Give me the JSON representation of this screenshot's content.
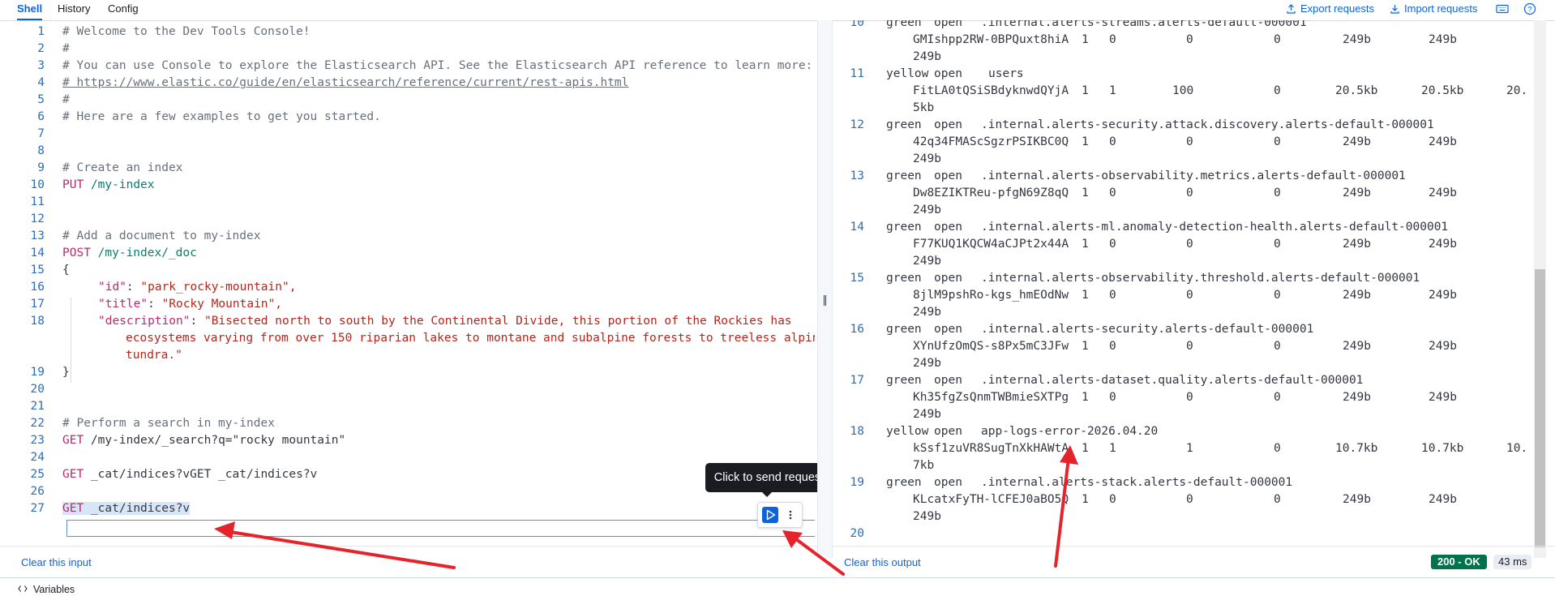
{
  "tabs": [
    {
      "label": "Shell",
      "active": true
    },
    {
      "label": "History",
      "active": false
    },
    {
      "label": "Config",
      "active": false
    }
  ],
  "toolbar": {
    "export_label": "Export requests",
    "import_label": "Import requests",
    "export_icon": "upload-icon",
    "import_icon": "download-icon",
    "keyboard_icon": "keyboard-icon",
    "help_icon": "help-icon"
  },
  "editor": {
    "lines": [
      {
        "n": "1",
        "text": "# Welcome to the Dev Tools Console!"
      },
      {
        "n": "2",
        "text": "#"
      },
      {
        "n": "3",
        "text": "# You can use Console to explore the Elasticsearch API. See the Elasticsearch API reference to learn more:"
      },
      {
        "n": "4",
        "text": "# https://www.elastic.co/guide/en/elasticsearch/reference/current/rest-apis.html"
      },
      {
        "n": "5",
        "text": "#"
      },
      {
        "n": "6",
        "text": "# Here are a few examples to get you started."
      },
      {
        "n": "7",
        "text": ""
      },
      {
        "n": "8",
        "text": ""
      },
      {
        "n": "9",
        "text": "# Create an index"
      },
      {
        "n": "10",
        "method": "PUT",
        "path": "/my-index"
      },
      {
        "n": "11",
        "text": ""
      },
      {
        "n": "12",
        "text": ""
      },
      {
        "n": "13",
        "text": "# Add a document to my-index"
      },
      {
        "n": "14",
        "method": "POST",
        "path": "/my-index/_doc"
      },
      {
        "n": "15",
        "text": "{"
      },
      {
        "n": "16",
        "key": "\"id\"",
        "value": "\"park_rocky-mountain\","
      },
      {
        "n": "17",
        "key": "\"title\"",
        "value": "\"Rocky Mountain\","
      },
      {
        "n": "18",
        "key": "\"description\"",
        "value": "\"Bisected north to south by the Continental Divide, this portion of the Rockies has"
      },
      {
        "n": "",
        "text": "ecosystems varying from over 150 riparian lakes to montane and subalpine forests to treeless alpine"
      },
      {
        "n": "",
        "text": "tundra.\""
      },
      {
        "n": "19",
        "text": "}"
      },
      {
        "n": "20",
        "text": ""
      },
      {
        "n": "21",
        "text": ""
      },
      {
        "n": "22",
        "text": "# Perform a search in my-index"
      },
      {
        "n": "23",
        "method": "GET",
        "path": "/my-index/_search?q=\"rocky mountain\""
      },
      {
        "n": "24",
        "text": ""
      },
      {
        "n": "25",
        "method": "GET",
        "path": "_cat/indices?vGET _cat/indices?v"
      },
      {
        "n": "26",
        "text": ""
      },
      {
        "n": "27",
        "method": "GET",
        "path": "_cat/indices?v"
      }
    ],
    "tooltip": "Click to send request",
    "send_icon": "play-icon",
    "more_icon": "more-vertical-icon",
    "clear_label": "Clear this input"
  },
  "output": {
    "rows": [
      {
        "n": "10",
        "health": "green",
        "status": "open",
        "index": ".internal.alerts-streams.alerts-default-000001",
        "uuid": "GMIshpp2RW-0BPQuxt8hiA",
        "pri": "1",
        "rep": "0",
        "docs": "0",
        "del": "0",
        "size": "249b",
        "pri_size": "249b",
        "wrap": "249b"
      },
      {
        "n": "11",
        "health": "yellow",
        "status": "open",
        "index": "users",
        "uuid": "FitLA0tQSiSBdyknwdQYjA",
        "pri": "1",
        "rep": "1",
        "docs": "100",
        "del": "0",
        "size": "20.5kb",
        "pri_size": "20.5kb",
        "extra": "20.",
        "wrap": "5kb"
      },
      {
        "n": "12",
        "health": "green",
        "status": "open",
        "index": ".internal.alerts-security.attack.discovery.alerts-default-000001",
        "uuid": "42q34FMAScSgzrPSIKBC0Q",
        "pri": "1",
        "rep": "0",
        "docs": "0",
        "del": "0",
        "size": "249b",
        "pri_size": "249b",
        "wrap": "249b"
      },
      {
        "n": "13",
        "health": "green",
        "status": "open",
        "index": ".internal.alerts-observability.metrics.alerts-default-000001",
        "uuid": "Dw8EZIKTReu-pfgN69Z8qQ",
        "pri": "1",
        "rep": "0",
        "docs": "0",
        "del": "0",
        "size": "249b",
        "pri_size": "249b",
        "wrap": "249b"
      },
      {
        "n": "14",
        "health": "green",
        "status": "open",
        "index": ".internal.alerts-ml.anomaly-detection-health.alerts-default-000001",
        "uuid": "F77KUQ1KQCW4aCJPt2x44A",
        "pri": "1",
        "rep": "0",
        "docs": "0",
        "del": "0",
        "size": "249b",
        "pri_size": "249b",
        "wrap": "249b"
      },
      {
        "n": "15",
        "health": "green",
        "status": "open",
        "index": ".internal.alerts-observability.threshold.alerts-default-000001",
        "uuid": "8jlM9pshRo-kgs_hmEOdNw",
        "pri": "1",
        "rep": "0",
        "docs": "0",
        "del": "0",
        "size": "249b",
        "pri_size": "249b",
        "wrap": "249b"
      },
      {
        "n": "16",
        "health": "green",
        "status": "open",
        "index": ".internal.alerts-security.alerts-default-000001",
        "uuid": "XYnUfzOmQS-s8Px5mC3JFw",
        "pri": "1",
        "rep": "0",
        "docs": "0",
        "del": "0",
        "size": "249b",
        "pri_size": "249b",
        "wrap": "249b"
      },
      {
        "n": "17",
        "health": "green",
        "status": "open",
        "index": ".internal.alerts-dataset.quality.alerts-default-000001",
        "uuid": "Kh35fgZsQnmTWBmieSXTPg",
        "pri": "1",
        "rep": "0",
        "docs": "0",
        "del": "0",
        "size": "249b",
        "pri_size": "249b",
        "wrap": "249b"
      },
      {
        "n": "18",
        "health": "yellow",
        "status": "open",
        "index": "app-logs-error-2026.04.20",
        "uuid": "kSsf1zuVR8SugTnXkHAWtA",
        "pri": "1",
        "rep": "1",
        "docs": "1",
        "del": "0",
        "size": "10.7kb",
        "pri_size": "10.7kb",
        "extra": "10.",
        "wrap": "7kb"
      },
      {
        "n": "19",
        "health": "green",
        "status": "open",
        "index": ".internal.alerts-stack.alerts-default-000001",
        "uuid": "KLcatxFyTH-lCFEJ0aBO5Q",
        "pri": "1",
        "rep": "0",
        "docs": "0",
        "del": "0",
        "size": "249b",
        "pri_size": "249b",
        "wrap": "249b"
      }
    ],
    "last_line": "20",
    "clear_label": "Clear this output",
    "status": "200 - OK",
    "time": "43 ms"
  },
  "variables": {
    "label": "Variables",
    "icon": "code-icon"
  },
  "colors": {
    "accent": "#0b64dd",
    "status_ok": "#00734c",
    "annotation_arrow": "#e5232a"
  }
}
